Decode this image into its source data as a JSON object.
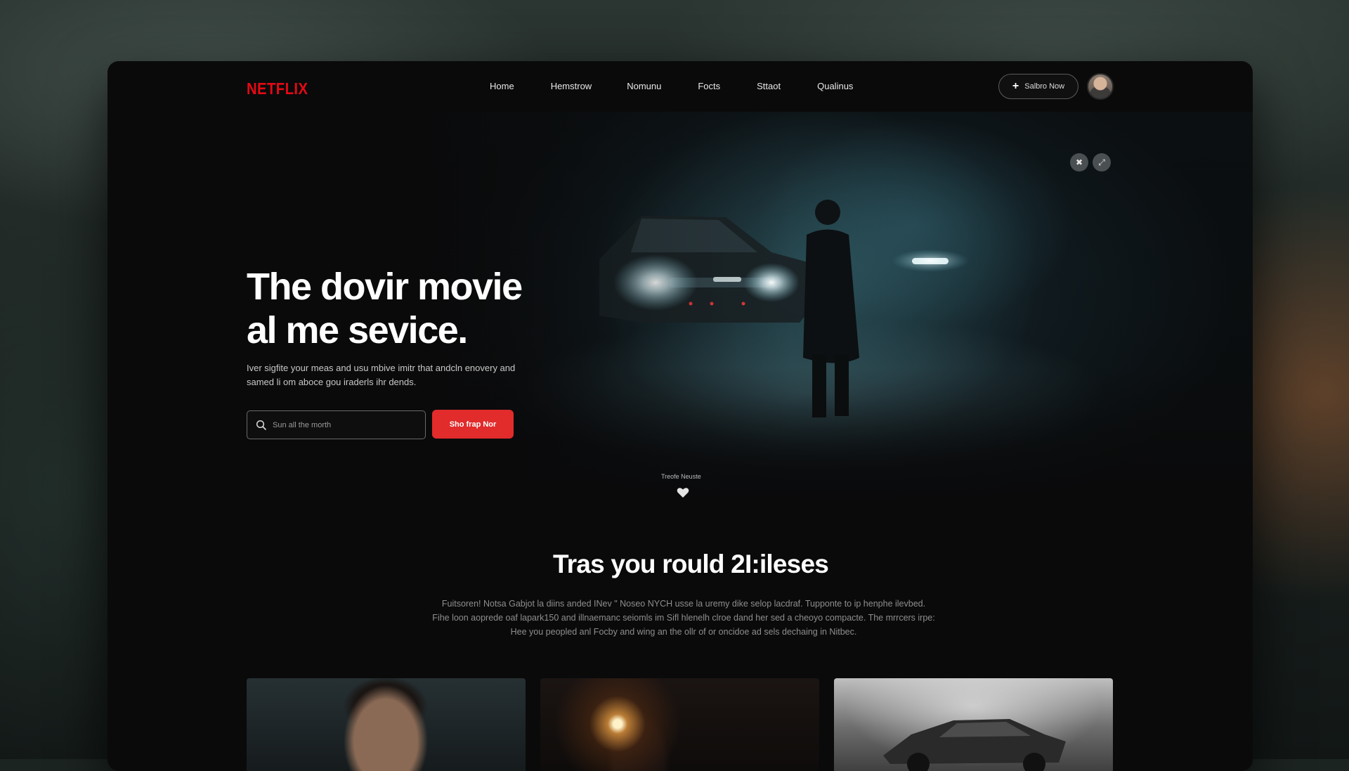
{
  "brand": {
    "logo_text": "NETFLIX",
    "accent_color": "#e50914"
  },
  "nav": {
    "links": [
      "Home",
      "Hemstrow",
      "Nomunu",
      "Focts",
      "Sttaot",
      "Qualinus"
    ],
    "subscribe_label": "Salbro Now"
  },
  "hero": {
    "controls": [
      "close-icon",
      "share-icon"
    ],
    "title_line1": "The dovir movie",
    "title_line2": "al me sevice.",
    "description_line1": "Iver sigfite your meas and usu mbive imitr that andcln enovery and",
    "description_line2": "samed li om aboce gou iraderls ihr dends.",
    "search_placeholder": "Sun all the morth",
    "cta_label": "Sho frap Nor",
    "trending_label": "Treofe Neuste"
  },
  "section": {
    "title": "Tras you rould 2I:ileses",
    "body_line1": "Fuitsoren! Notsa Gabjot la diins anded INev \" Noseo NYCH usse la uremy dike selop lacdraf. Tupponte to ip henphe ilevbed.",
    "body_line2": "Fihe loon aoprede oaf lapark150 and illnaemanc seiomls im Sifl hlenelh clroe dand her sed a cheoyo compacte. The mrrcers irpe:",
    "body_line3": "Hee you peopled anl Focby and wing an the ollr of or oncidoe ad sels dechaing in Nitbec."
  },
  "cards": [
    "portrait-man",
    "night-fire-scene",
    "vintage-car"
  ]
}
